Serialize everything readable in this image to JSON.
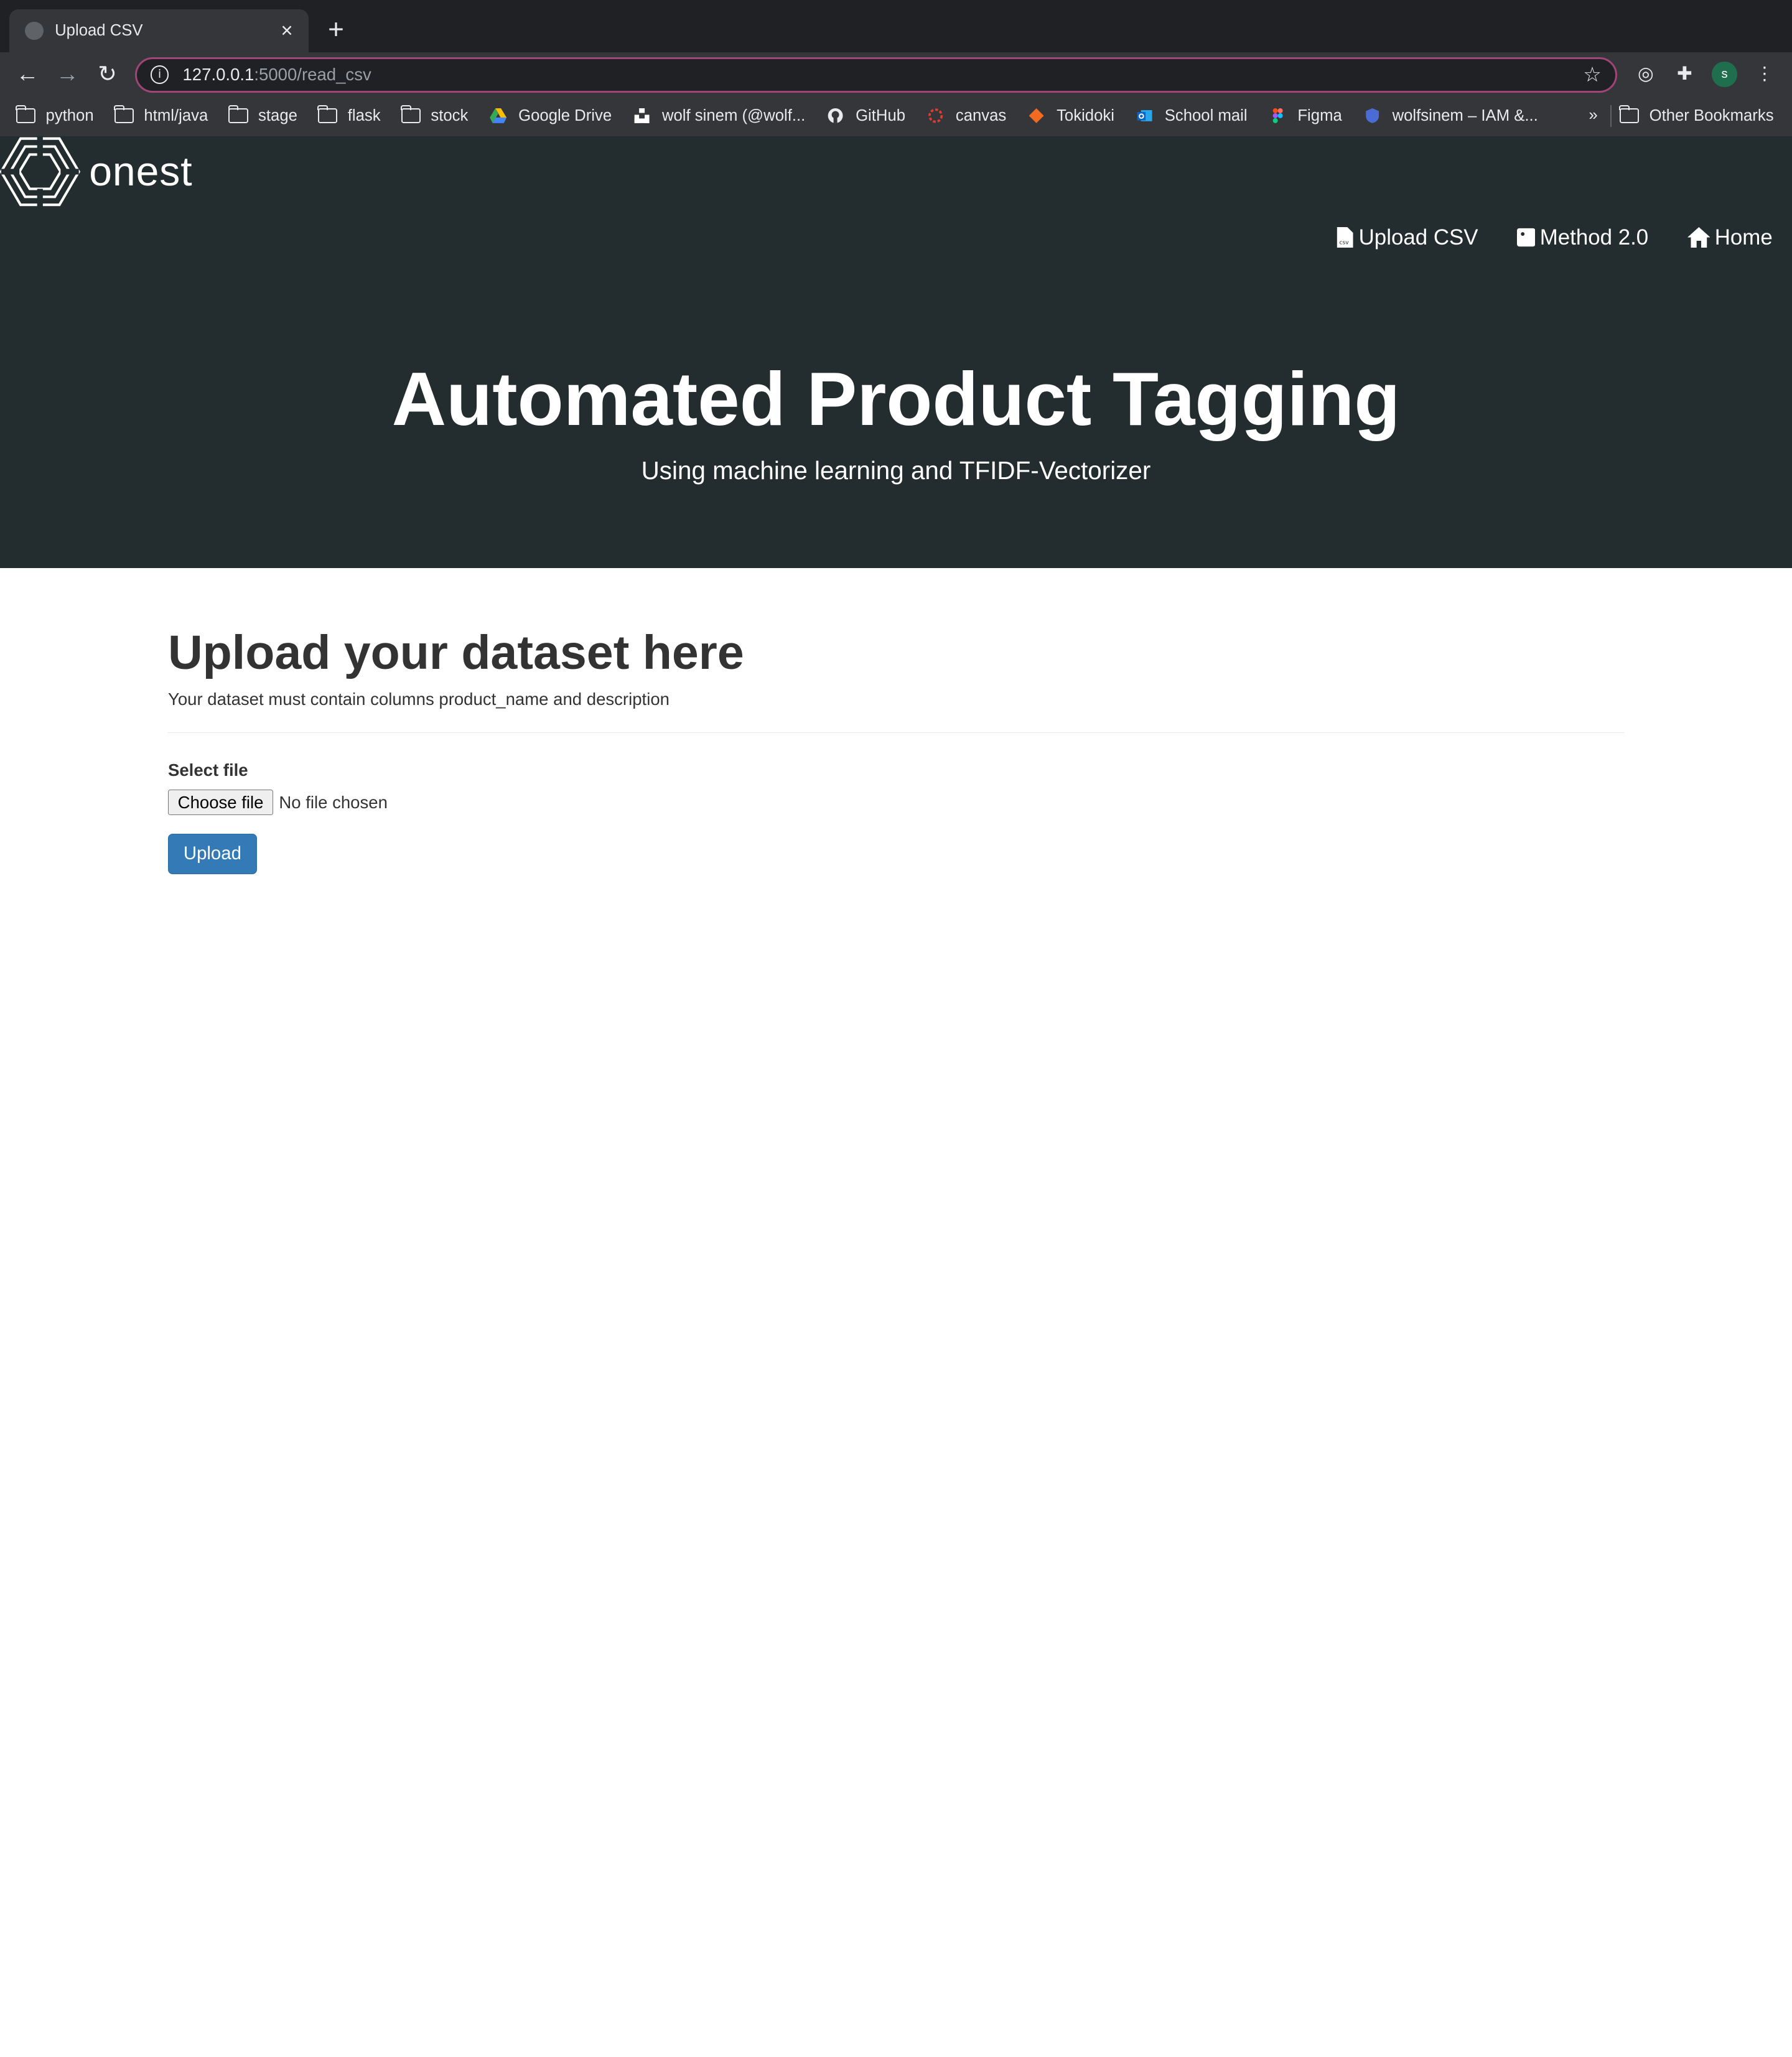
{
  "browser": {
    "tab_title": "Upload CSV",
    "tab_close": "×",
    "new_tab": "+",
    "url_host": "127.0.0.1",
    "url_rest": ":5000/read_csv",
    "bookmarks": [
      {
        "label": "python",
        "icon": "folder-icon"
      },
      {
        "label": "html/java",
        "icon": "folder-icon"
      },
      {
        "label": "stage",
        "icon": "folder-icon"
      },
      {
        "label": "flask",
        "icon": "folder-icon"
      },
      {
        "label": "stock",
        "icon": "folder-icon"
      },
      {
        "label": "Google Drive",
        "icon": "google-drive-icon",
        "color": "#34a853"
      },
      {
        "label": "wolf sinem (@wolf...",
        "icon": "unsplash-icon",
        "color": "#000000"
      },
      {
        "label": "GitHub",
        "icon": "github-icon",
        "color": "#e8eaed"
      },
      {
        "label": "canvas",
        "icon": "canvas-icon",
        "color": "#e33b30"
      },
      {
        "label": "Tokidoki",
        "icon": "tokidoki-icon",
        "color": "#f26b21"
      },
      {
        "label": "School mail",
        "icon": "outlook-icon",
        "color": "#0a64c8"
      },
      {
        "label": "Figma",
        "icon": "figma-icon",
        "color": "#f24e1e"
      },
      {
        "label": "wolfsinem – IAM &...",
        "icon": "shield-icon",
        "color": "#4a6cd4"
      }
    ],
    "more_bookmarks": "»",
    "other_bookmarks": "Other Bookmarks",
    "profile_initial": "s"
  },
  "site": {
    "logo_text": "onest",
    "nav": [
      {
        "label": "Upload CSV",
        "icon": "csv-file-icon"
      },
      {
        "label": "Method 2.0",
        "icon": "dice-icon"
      },
      {
        "label": "Home",
        "icon": "home-icon"
      }
    ],
    "hero_title": "Automated Product Tagging",
    "hero_subtitle": "Using machine learning and TFIDF-Vectorizer"
  },
  "upload": {
    "heading": "Upload your dataset here",
    "helper": "Your dataset must contain columns product_name and description",
    "field_label": "Select file",
    "choose_button": "Choose file",
    "file_status": "No file chosen",
    "submit_label": "Upload"
  },
  "colors": {
    "hero_bg": "#232c2e",
    "primary_button": "#337ab7",
    "omnibox_focus": "#a0447a"
  }
}
